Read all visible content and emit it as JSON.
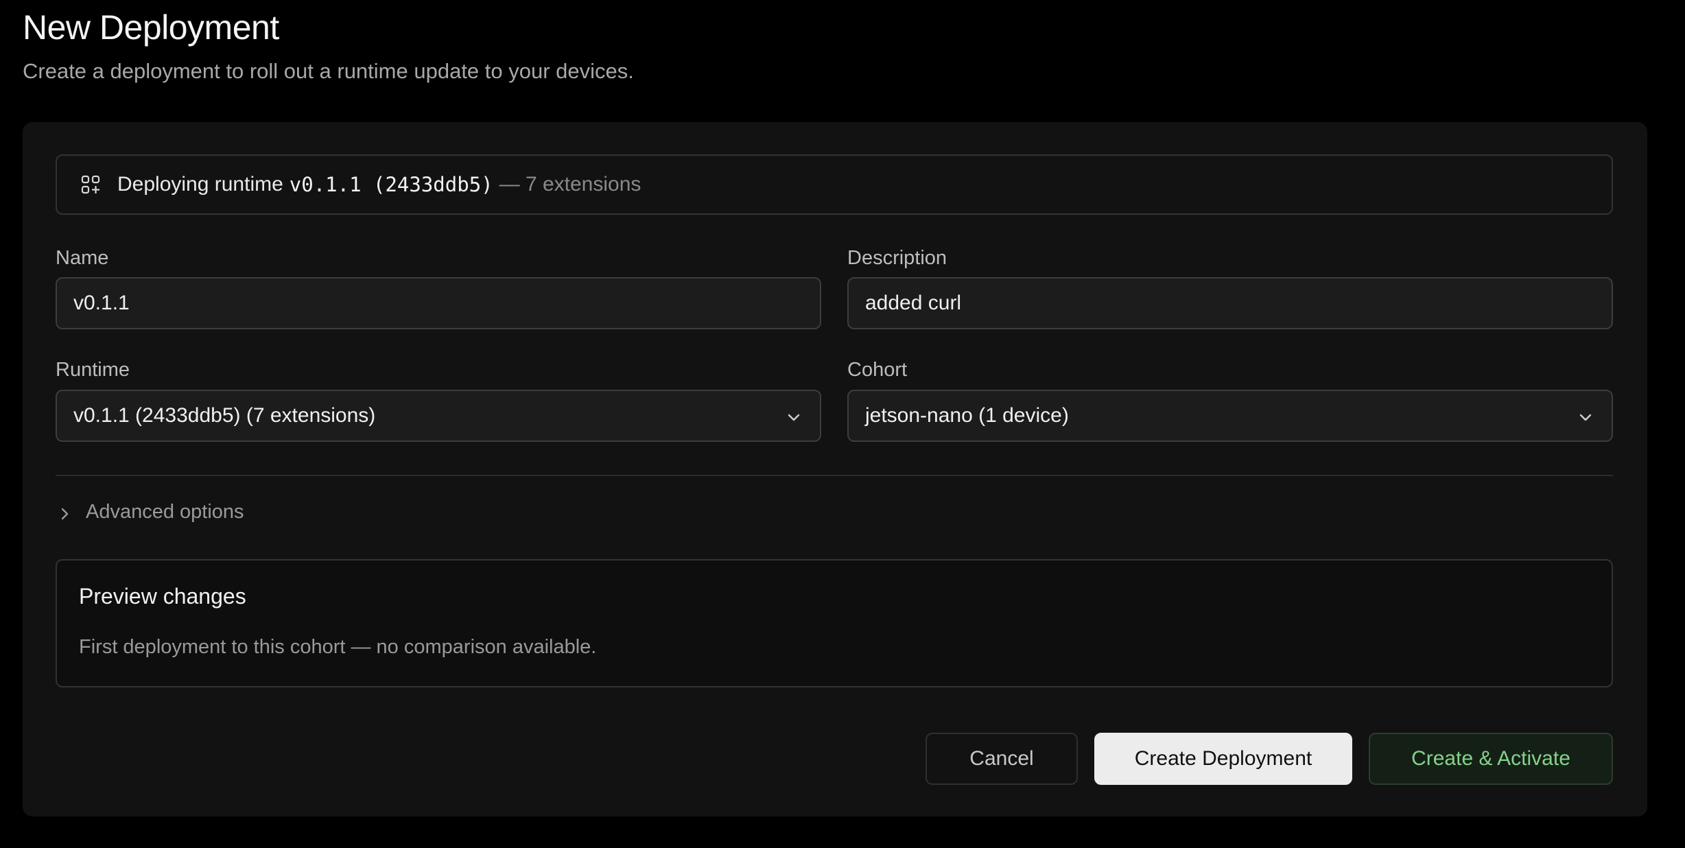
{
  "header": {
    "title": "New Deployment",
    "subtitle": "Create a deployment to roll out a runtime update to your devices."
  },
  "banner": {
    "icon": "apps-add-icon",
    "prefix": "Deploying runtime",
    "runtime_ref": "v0.1.1 (2433ddb5)",
    "extensions_text": "— 7 extensions"
  },
  "form": {
    "name": {
      "label": "Name",
      "value": "v0.1.1"
    },
    "description": {
      "label": "Description",
      "value": "added curl"
    },
    "runtime": {
      "label": "Runtime",
      "selected": "v0.1.1 (2433ddb5) (7 extensions)",
      "icon": "chevron-down-icon"
    },
    "cohort": {
      "label": "Cohort",
      "selected": "jetson-nano (1 device)",
      "icon": "chevron-down-icon"
    }
  },
  "advanced": {
    "label": "Advanced options",
    "icon": "chevron-right-icon"
  },
  "preview": {
    "title": "Preview changes",
    "message": "First deployment to this cohort — no comparison available."
  },
  "actions": {
    "cancel_label": "Cancel",
    "create_label": "Create Deployment",
    "create_activate_label": "Create & Activate"
  },
  "colors": {
    "background": "#000000",
    "card": "#121212",
    "accent_green": "#86d28c",
    "primary_button": "#ececec"
  }
}
